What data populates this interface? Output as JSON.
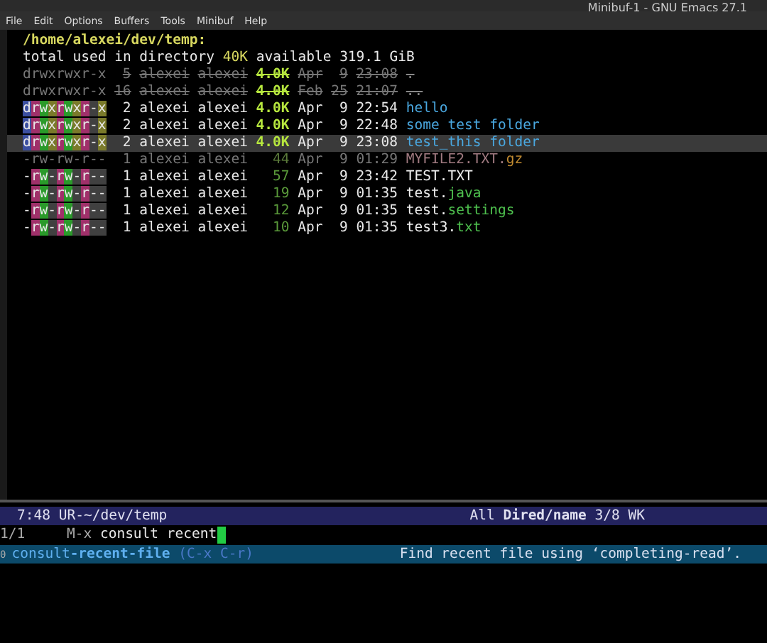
{
  "window": {
    "title": "Minibuf-1 - GNU Emacs 27.1"
  },
  "menu": [
    "File",
    "Edit",
    "Options",
    "Buffers",
    "Tools",
    "Minibuf",
    "Help"
  ],
  "buffer": {
    "directory": "/home/alexei/dev/temp:",
    "summary": {
      "label": "total used in directory",
      "used": "40K",
      "available_label": "available",
      "available": "319.1 GiB"
    },
    "rows": [
      {
        "kind": "dir",
        "perms": "drwxrwxr-x",
        "links": "5",
        "owner": "alexei",
        "group": "alexei",
        "size": "4.0K",
        "month": "Apr",
        "day": "9",
        "time": "23:08",
        "name": ".",
        "ext": "",
        "dimmed": true,
        "struck": true,
        "selected": false
      },
      {
        "kind": "dir",
        "perms": "drwxrwxr-x",
        "links": "16",
        "owner": "alexei",
        "group": "alexei",
        "size": "4.0K",
        "month": "Feb",
        "day": "25",
        "time": "21:07",
        "name": "..",
        "ext": "",
        "dimmed": true,
        "struck": true,
        "selected": false
      },
      {
        "kind": "dir",
        "perms": "drwxrwxr-x",
        "links": "2",
        "owner": "alexei",
        "group": "alexei",
        "size": "4.0K",
        "month": "Apr",
        "day": "9",
        "time": "22:54",
        "name": "hello",
        "ext": "",
        "dimmed": false,
        "struck": false,
        "selected": false
      },
      {
        "kind": "dir",
        "perms": "drwxrwxr-x",
        "links": "2",
        "owner": "alexei",
        "group": "alexei",
        "size": "4.0K",
        "month": "Apr",
        "day": "9",
        "time": "22:48",
        "name": "some test folder",
        "ext": "",
        "dimmed": false,
        "struck": false,
        "selected": false
      },
      {
        "kind": "dir",
        "perms": "drwxrwxr-x",
        "links": "2",
        "owner": "alexei",
        "group": "alexei",
        "size": "4.0K",
        "month": "Apr",
        "day": "9",
        "time": "23:08",
        "name": "test_this folder",
        "ext": "",
        "dimmed": false,
        "struck": false,
        "selected": true
      },
      {
        "kind": "file",
        "perms": "-rw-rw-r--",
        "links": "1",
        "owner": "alexei",
        "group": "alexei",
        "size": "44",
        "month": "Apr",
        "day": "9",
        "time": "01:29",
        "name": "MYFILE2.TXT.",
        "ext": "gz",
        "dimmed": true,
        "struck": false,
        "selected": false
      },
      {
        "kind": "file",
        "perms": "-rw-rw-r--",
        "links": "1",
        "owner": "alexei",
        "group": "alexei",
        "size": "57",
        "month": "Apr",
        "day": "9",
        "time": "23:42",
        "name": "TEST.TXT",
        "ext": "",
        "dimmed": false,
        "struck": false,
        "selected": false
      },
      {
        "kind": "file",
        "perms": "-rw-rw-r--",
        "links": "1",
        "owner": "alexei",
        "group": "alexei",
        "size": "19",
        "month": "Apr",
        "day": "9",
        "time": "01:35",
        "name": "test.",
        "ext": "java",
        "dimmed": false,
        "struck": false,
        "selected": false
      },
      {
        "kind": "file",
        "perms": "-rw-rw-r--",
        "links": "1",
        "owner": "alexei",
        "group": "alexei",
        "size": "12",
        "month": "Apr",
        "day": "9",
        "time": "01:35",
        "name": "test.",
        "ext": "settings",
        "dimmed": false,
        "struck": false,
        "selected": false
      },
      {
        "kind": "file",
        "perms": "-rw-rw-r--",
        "links": "1",
        "owner": "alexei",
        "group": "alexei",
        "size": "10",
        "month": "Apr",
        "day": "9",
        "time": "01:35",
        "name": "test3.",
        "ext": "txt",
        "dimmed": false,
        "struck": false,
        "selected": false
      }
    ]
  },
  "mode_line": {
    "left": "7:48 UR-~/dev/temp",
    "right": "All **Dired/name** 3/8 WK"
  },
  "minibuffer": {
    "count": "1/1",
    "prompt": "M-x",
    "input": "consult recent"
  },
  "completions": [
    {
      "index": "0",
      "command": "consult**-recent-file**",
      "keys": "(C-x C-r)",
      "description": "Find recent file using ‘completing-read’.",
      "selected": true
    }
  ]
}
